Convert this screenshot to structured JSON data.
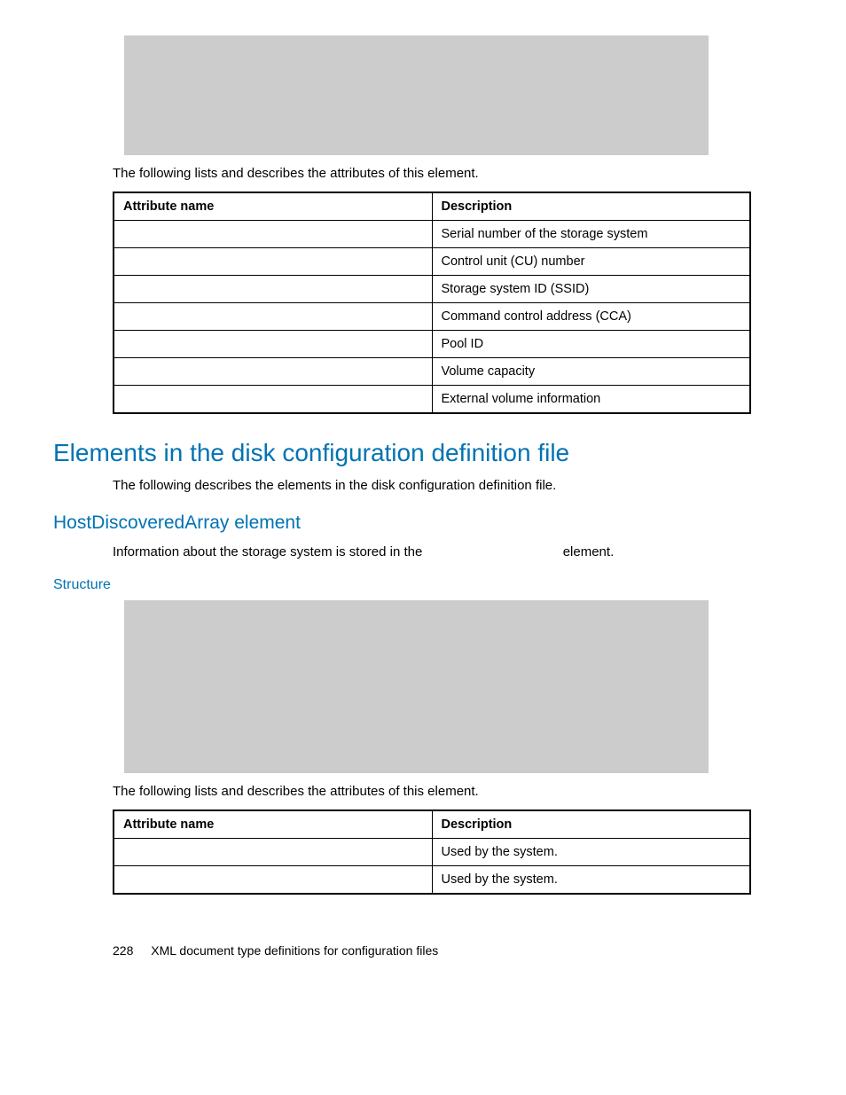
{
  "intro1": "The following lists and describes the attributes of this element.",
  "table1": {
    "headers": [
      "Attribute name",
      "Description"
    ],
    "rows": [
      [
        "",
        "Serial number of the storage system"
      ],
      [
        "",
        "Control unit (CU) number"
      ],
      [
        "",
        "Storage system ID (SSID)"
      ],
      [
        "",
        "Command control address (CCA)"
      ],
      [
        "",
        "Pool ID"
      ],
      [
        "",
        "Volume capacity"
      ],
      [
        "",
        "External volume information"
      ]
    ]
  },
  "section_title": "Elements in the disk configuration definition file",
  "section_body": "The following describes the elements in the disk configuration definition file.",
  "subsection_title": "HostDiscoveredArray element",
  "subsection_body_pre": "Information about the storage system is stored in the ",
  "subsection_body_post": " element.",
  "structure_title": "Structure",
  "intro2": "The following lists and describes the attributes of this element.",
  "table2": {
    "headers": [
      "Attribute name",
      "Description"
    ],
    "rows": [
      [
        "",
        "Used by the system."
      ],
      [
        "",
        "Used by the system."
      ]
    ]
  },
  "footer": {
    "page": "228",
    "title": "XML document type definitions for configuration files"
  }
}
